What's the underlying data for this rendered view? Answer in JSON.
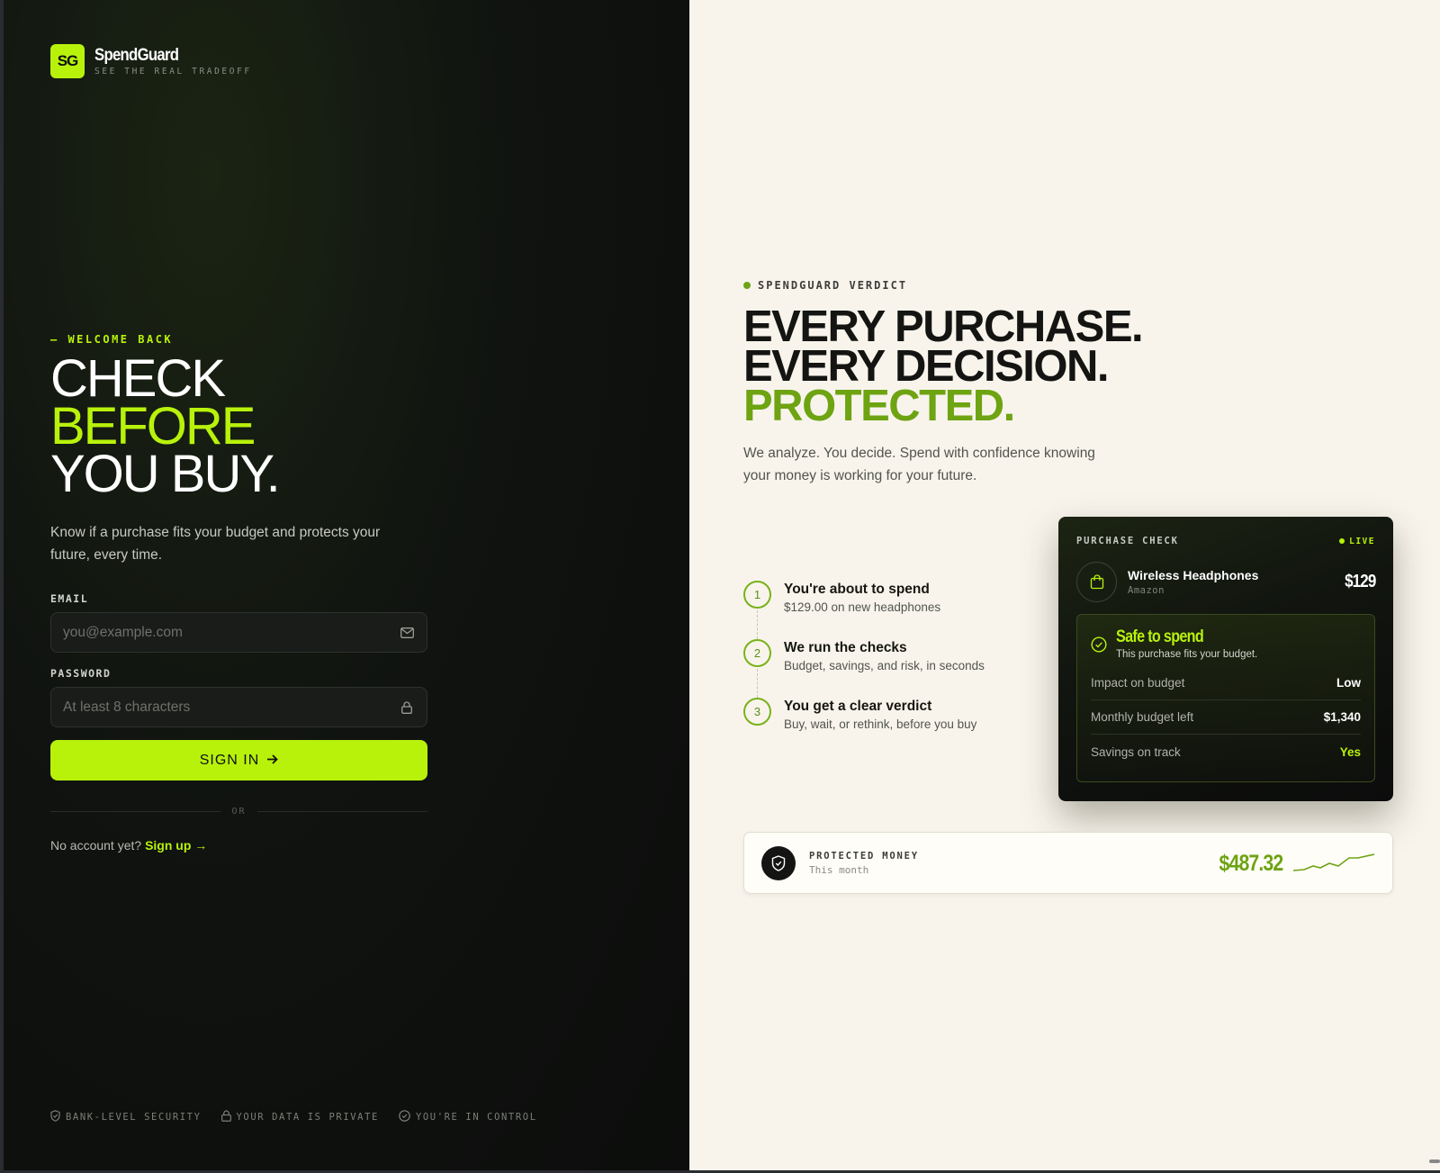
{
  "brand": {
    "logo_initials": "SG",
    "name": "SpendGuard",
    "tagline": "SEE THE REAL TRADEOFF",
    "accent_color": "#b8f20b"
  },
  "login": {
    "kicker": "— WELCOME BACK",
    "headline": [
      "CHECK",
      "BEFORE",
      "YOU BUY."
    ],
    "lead": "Know if a purchase fits your budget and protects your future, every time.",
    "email_label": "EMAIL",
    "email_placeholder": "you@example.com",
    "password_label": "PASSWORD",
    "password_placeholder": "At least 8 characters",
    "signin_label": "SIGN IN",
    "divider_text": "OR",
    "no_account_text": "No account yet?",
    "signup_label": "Sign up",
    "icons": {
      "email": "mail-icon",
      "password": "lock-icon",
      "signin": "arrow-right-icon"
    }
  },
  "footer_badges": [
    {
      "icon": "shield-icon",
      "label": "BANK-LEVEL SECURITY"
    },
    {
      "icon": "lock-icon",
      "label": "YOUR DATA IS PRIVATE"
    },
    {
      "icon": "check-circle-icon",
      "label": "YOU'RE IN CONTROL"
    }
  ],
  "promo": {
    "kicker": "SPENDGUARD VERDICT",
    "headline": [
      "EVERY PURCHASE.",
      "EVERY DECISION.",
      "PROTECTED."
    ],
    "lead": "We analyze. You decide. Spend with confidence knowing your money is working for your future.",
    "steps": [
      {
        "num": "1",
        "title": "You're about to spend",
        "desc": "$129.00 on new headphones"
      },
      {
        "num": "2",
        "title": "We run the checks",
        "desc": "Budget, savings, and risk, in seconds"
      },
      {
        "num": "3",
        "title": "You get a clear verdict",
        "desc": "Buy, wait, or rethink, before you buy"
      }
    ],
    "card": {
      "kicker": "PURCHASE CHECK",
      "live_label": "LIVE",
      "product_name": "Wireless Headphones",
      "product_store": "Amazon",
      "price": "$129",
      "verdict_title": "Safe to spend",
      "verdict_sub": "This purchase fits your budget.",
      "rows": [
        {
          "key": "Impact on budget",
          "value": "Low"
        },
        {
          "key": "Monthly budget left",
          "value": "$1,340"
        },
        {
          "key": "Savings on track",
          "value": "Yes"
        }
      ]
    },
    "protected": {
      "title": "PROTECTED MONEY",
      "sub": "This month",
      "amount": "$487.32"
    }
  }
}
